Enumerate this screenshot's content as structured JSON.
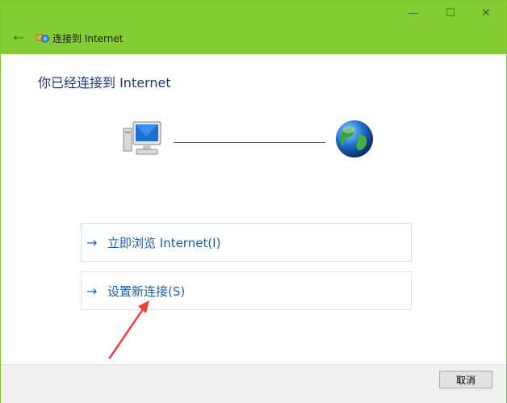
{
  "window": {
    "title": "连接到 Internet",
    "back_icon": "←",
    "min_icon": "—",
    "max_icon": "☐",
    "close_icon": "✕"
  },
  "heading": "你已经连接到 Internet",
  "links": [
    {
      "arrow": "→",
      "label": "立即浏览 Internet(I)"
    },
    {
      "arrow": "→",
      "label": "设置新连接(S)"
    }
  ],
  "footer": {
    "cancel_label": "取消"
  },
  "colors": {
    "titlebar": "#84cc34",
    "link": "#1c5fb0",
    "heading": "#1e3a6e",
    "annotation_arrow": "#e8433a"
  },
  "icons": [
    "network-icon",
    "computer-icon",
    "globe-icon"
  ]
}
